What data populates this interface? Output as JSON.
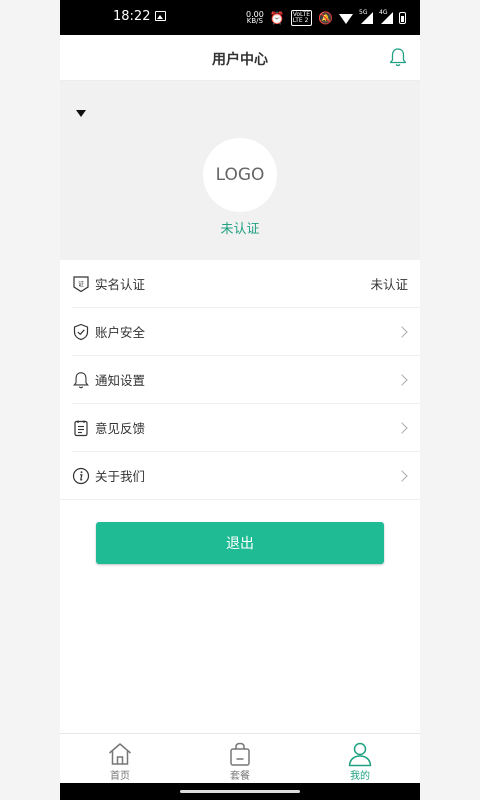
{
  "status_bar": {
    "time": "18:22",
    "net_speed_value": "0.00",
    "net_speed_unit": "KB/S",
    "volte_top": "VoLTE",
    "volte_bottom": "LTE 2",
    "signal1_label": "5G",
    "signal2_label": "4G"
  },
  "header": {
    "title": "用户中心",
    "notification_icon": "bell-icon"
  },
  "profile": {
    "logo_text": "LOGO",
    "auth_status": "未认证"
  },
  "menu": {
    "items": [
      {
        "label": "实名认证",
        "icon": "id-card-icon",
        "value": "未认证"
      },
      {
        "label": "账户安全",
        "icon": "shield-check-icon"
      },
      {
        "label": "通知设置",
        "icon": "bell-icon"
      },
      {
        "label": "意见反馈",
        "icon": "clipboard-icon"
      },
      {
        "label": "关于我们",
        "icon": "info-icon"
      }
    ]
  },
  "logout_label": "退出",
  "tabbar": {
    "tabs": [
      {
        "label": "首页",
        "icon": "home-icon",
        "active": false
      },
      {
        "label": "套餐",
        "icon": "bag-icon",
        "active": false
      },
      {
        "label": "我的",
        "icon": "user-icon",
        "active": true
      }
    ]
  },
  "colors": {
    "accent": "#1fbb94",
    "accent_text": "#1fa182"
  }
}
